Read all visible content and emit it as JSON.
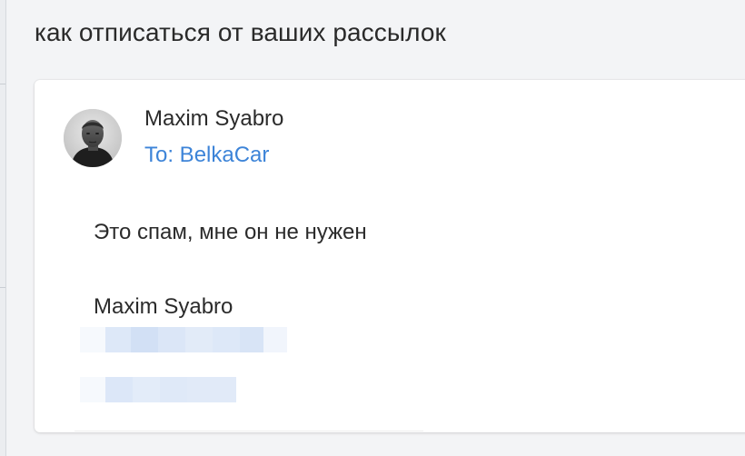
{
  "message": {
    "subject": "как отписаться от ваших рассылок",
    "sender_name": "Maxim Syabro",
    "recipient": "To: BelkaCar",
    "body": "Это спам, мне он не нужен",
    "signature_name": "Maxim Syabro"
  },
  "icons": {
    "avatar": "person-photo-icon"
  },
  "colors": {
    "recipient_link": "#3d84d8",
    "redaction": "#dce8f8",
    "background": "#f3f4f6",
    "card": "#ffffff"
  }
}
